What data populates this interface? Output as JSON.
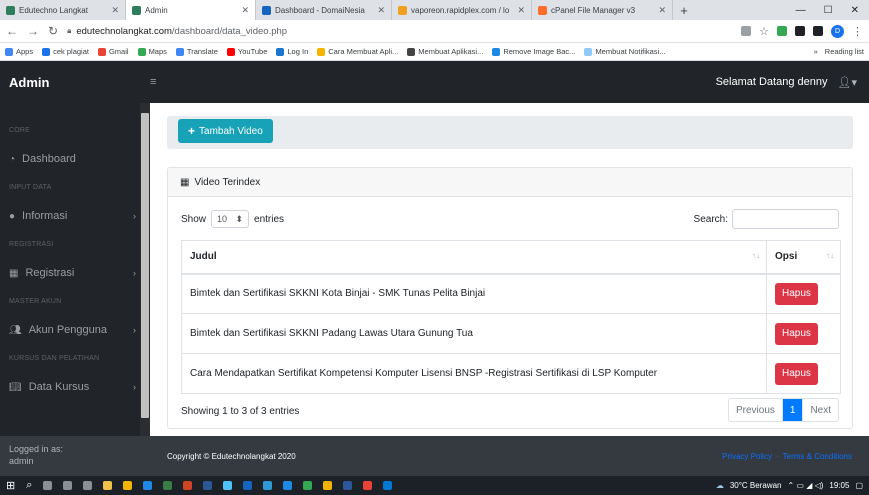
{
  "browser": {
    "tabs": [
      {
        "label": "Edutechno Langkat",
        "color": "#2e7d5b",
        "active": false
      },
      {
        "label": "Admin",
        "color": "#2e7d5b",
        "active": true
      },
      {
        "label": "Dashboard - DomaiNesia",
        "color": "#1565c0",
        "active": false
      },
      {
        "label": "vaporeon.rapidplex.com / lo",
        "color": "#f0a020",
        "active": false
      },
      {
        "label": "cPanel File Manager v3",
        "color": "#ff6c2c",
        "active": false
      }
    ],
    "new_tab": "+",
    "url_host": "edutechnolangkat.com",
    "url_path": "/dashboard/data_video.php",
    "profile_initial": "D",
    "bookmarks": [
      {
        "label": "Apps",
        "color": "#4285f4"
      },
      {
        "label": "cek plagiat",
        "color": "#1a73e8"
      },
      {
        "label": "Gmail",
        "color": "#ea4335"
      },
      {
        "label": "Maps",
        "color": "#34a853"
      },
      {
        "label": "Translate",
        "color": "#4285f4"
      },
      {
        "label": "YouTube",
        "color": "#ff0000"
      },
      {
        "label": "Log In",
        "color": "#1976d2"
      },
      {
        "label": "Cara Membuat Apli...",
        "color": "#f4b400"
      },
      {
        "label": "Membuat Aplikasi...",
        "color": "#444444"
      },
      {
        "label": "Remove Image Bac...",
        "color": "#1e88e5"
      },
      {
        "label": "Membuat Notifikasi...",
        "color": "#90caf9"
      }
    ],
    "bookmarks_more": "»",
    "reading_list": "Reading list"
  },
  "navbar": {
    "brand": "Admin",
    "toggle_icon": "≡",
    "greeting": "Selamat Datang denny"
  },
  "sidebar": {
    "sections": [
      {
        "heading": "CORE",
        "item": "Dashboard",
        "icon": "tachometer-icon",
        "has_chevron": false
      },
      {
        "heading": "INPUT DATA",
        "item": "Informasi",
        "icon": "info-icon",
        "has_chevron": true
      },
      {
        "heading": "REGISTRASI",
        "item": "Registrasi",
        "icon": "table-icon",
        "has_chevron": true
      },
      {
        "heading": "MASTER AKUN",
        "item": "Akun Pengguna",
        "icon": "users-icon",
        "has_chevron": true
      },
      {
        "heading": "KURSUS DAN PELATIHAN",
        "item": "Data Kursus",
        "icon": "book-icon",
        "has_chevron": true
      }
    ],
    "footer_label": "Logged in as:",
    "footer_user": "admin"
  },
  "content": {
    "add_button": "Tambah Video",
    "card_title": "Video Terindex",
    "length_prefix": "Show",
    "length_value": "10",
    "length_suffix": "entries",
    "search_label": "Search:",
    "search_value": "",
    "columns": [
      "Judul",
      "Opsi"
    ],
    "rows": [
      {
        "judul": "Bimtek dan Sertifikasi SKKNI Kota Binjai - SMK Tunas Pelita Binjai",
        "action": "Hapus"
      },
      {
        "judul": "Bimtek dan Sertifikasi SKKNI Padang Lawas Utara Gunung Tua",
        "action": "Hapus"
      },
      {
        "judul": "Cara Mendapatkan Sertifikat Kompetensi Komputer Lisensi BNSP -Registrasi Sertifikasi di LSP Komputer",
        "action": "Hapus"
      }
    ],
    "info": "Showing 1 to 3 of 3 entries",
    "pager": {
      "previous": "Previous",
      "current": "1",
      "next": "Next"
    }
  },
  "footer": {
    "copyright": "Copyright © Edutechnolangkat 2020",
    "privacy": "Privacy Policy",
    "sep": "·",
    "terms": "Terms & Conditions"
  },
  "taskbar": {
    "weather": "30°C Berawan",
    "time": "19:05",
    "app_colors": [
      "#8b8f94",
      "#8b8f94",
      "#8b8f94",
      "#f0c24a",
      "#f4b400",
      "#1e88e5",
      "#3a7d44",
      "#d04423",
      "#2b5797",
      "#4fc3f7",
      "#1565c0",
      "#2d9ad6",
      "#1e88e5",
      "#34a853",
      "#f4b400",
      "#2b579a",
      "#ea4335",
      "#0078d4"
    ]
  },
  "colors": {
    "accent": "#17a2b8",
    "danger": "#dc3545",
    "primary": "#007bff",
    "dark": "#212529"
  }
}
